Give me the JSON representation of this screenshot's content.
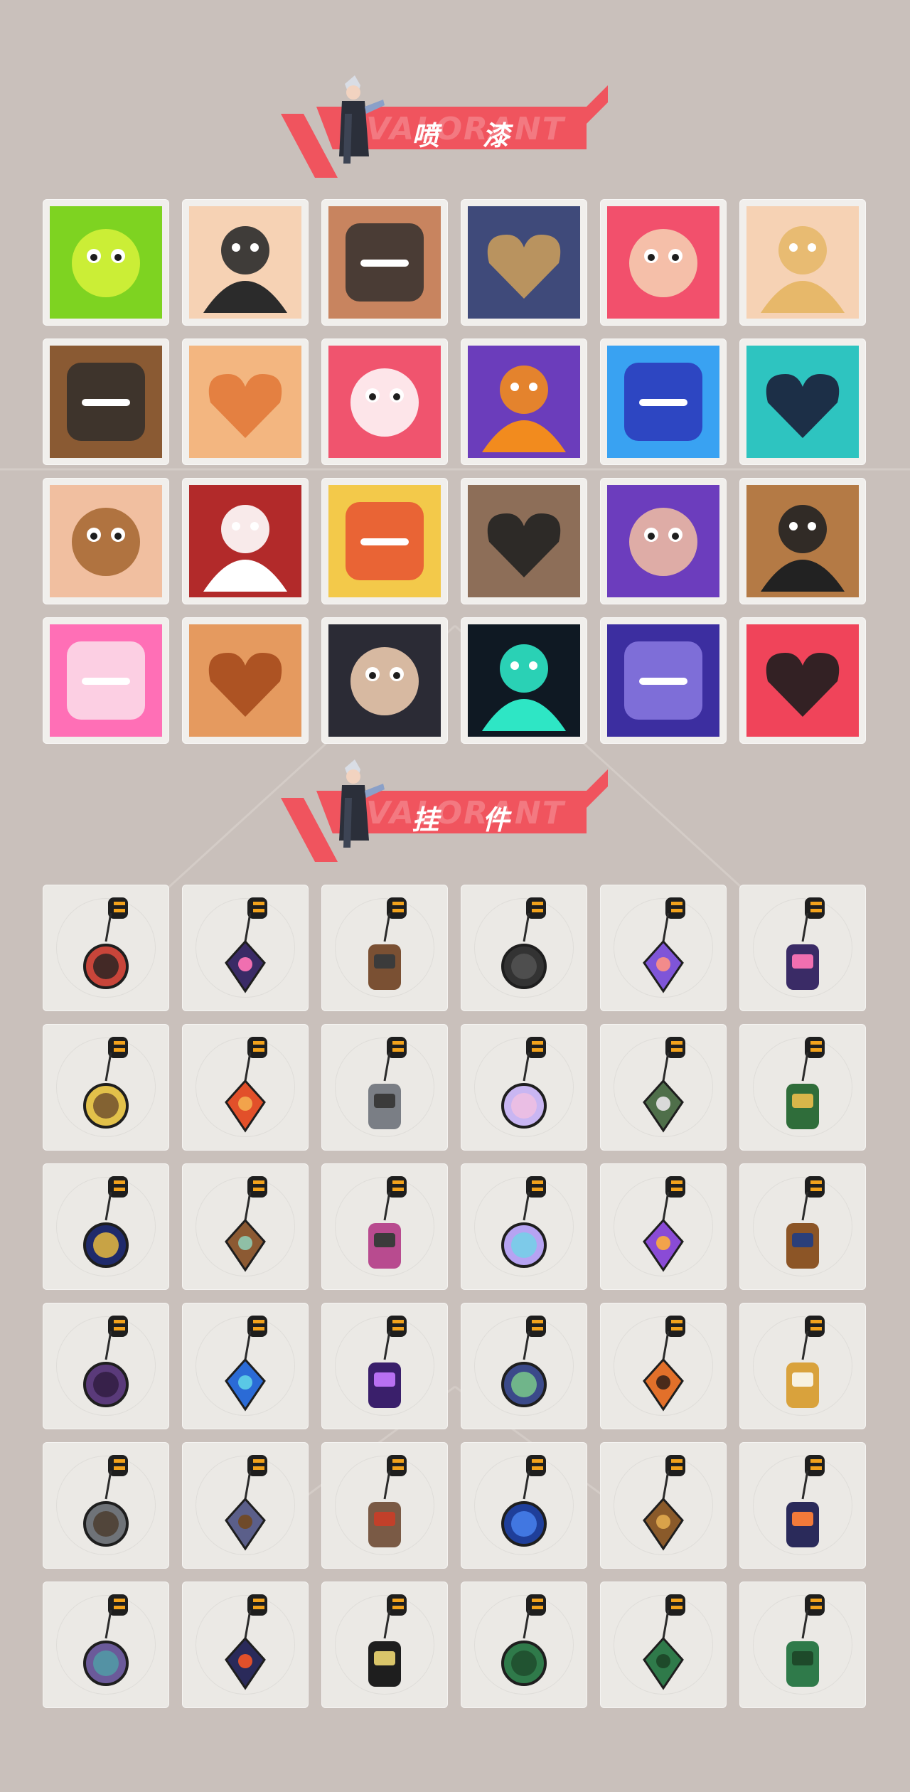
{
  "sections": {
    "sprays": {
      "title": "喷 漆",
      "ghost": "VALORANT",
      "items": [
        {
          "icon": "green-goo-spray-icon",
          "colors": [
            "#7ed321",
            "#d8f23a"
          ]
        },
        {
          "icon": "glasses-guy-shocked-spray-icon",
          "colors": [
            "#f6d2b4",
            "#2b2b2b"
          ]
        },
        {
          "icon": "glasses-guy-nervous-spray-icon",
          "colors": [
            "#c8845f",
            "#2b2b2b"
          ]
        },
        {
          "icon": "masked-hat-character-spray-icon",
          "colors": [
            "#3f4a7a",
            "#c79b5c"
          ]
        },
        {
          "icon": "heart-hands-spray-icon",
          "colors": [
            "#f2506c",
            "#f6d2b4"
          ]
        },
        {
          "icon": "sleepy-face-spray-icon",
          "colors": [
            "#f6d2b4",
            "#e7b86a"
          ]
        },
        {
          "icon": "sunglasses-bear-spray-icon",
          "colors": [
            "#8a5a33",
            "#2b2b2b"
          ]
        },
        {
          "icon": "happy-kid-face-spray-icon",
          "colors": [
            "#f3b680",
            "#e27a3a"
          ]
        },
        {
          "icon": "pixel-heart-spray-icon",
          "colors": [
            "#f0546e",
            "#ffffff"
          ]
        },
        {
          "icon": "snail-creature-spray-icon",
          "colors": [
            "#6b3dbb",
            "#f28b1e"
          ]
        },
        {
          "icon": "blue-dolphin-spray-icon",
          "colors": [
            "#39a2f2",
            "#2a2fb5"
          ]
        },
        {
          "icon": "striped-banner-spray-icon",
          "colors": [
            "#2ec4c0",
            "#1b1f3a"
          ]
        },
        {
          "icon": "bearded-man-glance-spray-icon",
          "colors": [
            "#f1bfa0",
            "#a5652f"
          ]
        },
        {
          "icon": "red-x-button-spray-icon",
          "colors": [
            "#b22a2a",
            "#ffffff"
          ]
        },
        {
          "icon": "lion-dance-spray-icon",
          "colors": [
            "#f3c94a",
            "#e64b2f"
          ]
        },
        {
          "icon": "pixel-sunglasses-cat-spray-icon",
          "colors": [
            "#8d6e58",
            "#222222"
          ]
        },
        {
          "icon": "purple-agent-spray-icon",
          "colors": [
            "#6c3dbd",
            "#f2c0a2"
          ]
        },
        {
          "icon": "bear-sunglasses-closeup-spray-icon",
          "colors": [
            "#b47a45",
            "#222222"
          ]
        },
        {
          "icon": "neon-heart-spray-icon",
          "colors": [
            "#ff6fb6",
            "#fbe7ef"
          ]
        },
        {
          "icon": "laughing-bearded-man-spray-icon",
          "colors": [
            "#e59a5f",
            "#a64b1d"
          ]
        },
        {
          "icon": "hooded-chibi-spray-icon",
          "colors": [
            "#2b2b35",
            "#f6d2b4"
          ]
        },
        {
          "icon": "valorant-splat-logo-spray-icon",
          "colors": [
            "#0f1923",
            "#2ee6c5"
          ]
        },
        {
          "icon": "purple-graffiti-spray-icon",
          "colors": [
            "#3c2ea0",
            "#8f7ee6"
          ]
        },
        {
          "icon": "red-valorant-circle-spray-icon",
          "colors": [
            "#f0445a",
            "#1e1e1e"
          ]
        }
      ]
    },
    "charms": {
      "title": "挂 件",
      "ghost": "VALORANT",
      "items": [
        {
          "icon": "rope-keychain-charm-icon",
          "colors": [
            "#c8453a",
            "#222222"
          ]
        },
        {
          "icon": "ep9-medallion-charm-icon",
          "colors": [
            "#3a2b66",
            "#f06fb0"
          ]
        },
        {
          "icon": "leather-holster-charm-icon",
          "colors": [
            "#7a5033",
            "#3b3b3b"
          ]
        },
        {
          "icon": "black-dragon-charm-icon",
          "colors": [
            "#333333",
            "#555555"
          ]
        },
        {
          "icon": "lava-lamp-charm-icon",
          "colors": [
            "#7f55d8",
            "#f28b8b"
          ]
        },
        {
          "icon": "ep9-medallion-charm-icon",
          "colors": [
            "#3a2b66",
            "#f06fb0"
          ]
        },
        {
          "icon": "yellow-taco-charm-icon",
          "colors": [
            "#e2c14a",
            "#6b4a2c"
          ]
        },
        {
          "icon": "red-skewer-charm-icon",
          "colors": [
            "#e2502a",
            "#f2a34b"
          ]
        },
        {
          "icon": "robot-figure-charm-icon",
          "colors": [
            "#7a7e85",
            "#3b3b3b"
          ]
        },
        {
          "icon": "pastel-spirit-charm-icon",
          "colors": [
            "#c9b6f2",
            "#f2c0e0"
          ]
        },
        {
          "icon": "green-robot-charm-icon",
          "colors": [
            "#4f6f4a",
            "#d9d9d9"
          ]
        },
        {
          "icon": "green-can-charm-icon",
          "colors": [
            "#2f6d3a",
            "#d9b64a"
          ]
        },
        {
          "icon": "ep7-medallion-charm-icon",
          "colors": [
            "#1f2a6b",
            "#f2c23c"
          ]
        },
        {
          "icon": "bottle-charm-icon",
          "colors": [
            "#8c5a33",
            "#8fbfa6"
          ]
        },
        {
          "icon": "jetski-charm-icon",
          "colors": [
            "#b84b8f",
            "#3b3b3b"
          ]
        },
        {
          "icon": "jellyfish-charm-icon",
          "colors": [
            "#b6a3f2",
            "#6fd3e6"
          ]
        },
        {
          "icon": "lotus-flame-charm-icon",
          "colors": [
            "#8a4bd6",
            "#f2a34b"
          ]
        },
        {
          "icon": "pretzel-charm-icon",
          "colors": [
            "#8c5526",
            "#2a3f7a"
          ]
        },
        {
          "icon": "purple-orb-claw-charm-icon",
          "colors": [
            "#5a3a7a",
            "#2e1c3e"
          ]
        },
        {
          "icon": "blue-manta-charm-icon",
          "colors": [
            "#2b6bd6",
            "#5ac8e6"
          ]
        },
        {
          "icon": "ep8-medallion-charm-icon",
          "colors": [
            "#3a1f6b",
            "#b870f2"
          ]
        },
        {
          "icon": "ufo-charm-icon",
          "colors": [
            "#3b4a8a",
            "#7ed08a"
          ]
        },
        {
          "icon": "orange-tiger-charm-icon",
          "colors": [
            "#e2702a",
            "#4a2a1a"
          ]
        },
        {
          "icon": "frying-pan-egg-charm-icon",
          "colors": [
            "#d9a23c",
            "#f7f1e0"
          ]
        },
        {
          "icon": "grey-piggy-charm-icon",
          "colors": [
            "#6f7378",
            "#4a3a2a"
          ]
        },
        {
          "icon": "blue-boot-charm-icon",
          "colors": [
            "#5b5f8a",
            "#6f4a2a"
          ]
        },
        {
          "icon": "camera-bag-charm-icon",
          "colors": [
            "#7a5a45",
            "#c2402a"
          ]
        },
        {
          "icon": "ep8-blue-medallion-charm-icon",
          "colors": [
            "#1f3f9a",
            "#4a86f2"
          ]
        },
        {
          "icon": "bronze-lion-charm-icon",
          "colors": [
            "#8a5a2a",
            "#d9a24a"
          ]
        },
        {
          "icon": "ep7-orange-medallion-charm-icon",
          "colors": [
            "#2a2a5a",
            "#f27a3a"
          ]
        },
        {
          "icon": "tassel-charm-icon",
          "colors": [
            "#6b5a9a",
            "#4fa0a6"
          ]
        },
        {
          "icon": "ep7-red-medallion-charm-icon",
          "colors": [
            "#2a2a5a",
            "#e2502a"
          ]
        },
        {
          "icon": "valorant-black-pendant-charm-icon",
          "colors": [
            "#1e1e1e",
            "#d9c56a"
          ]
        },
        {
          "icon": "green-ep-pendant-charm-icon",
          "colors": [
            "#2f7a4a",
            "#1e4a2a"
          ]
        },
        {
          "icon": "green-ep-pendant-charm-icon",
          "colors": [
            "#2f7a4a",
            "#1e4a2a"
          ]
        },
        {
          "icon": "green-ep-pendant-charm-icon",
          "colors": [
            "#2f7a4a",
            "#1e4a2a"
          ]
        }
      ]
    }
  },
  "accent": "#f0545e",
  "background": "#c9c0bb"
}
